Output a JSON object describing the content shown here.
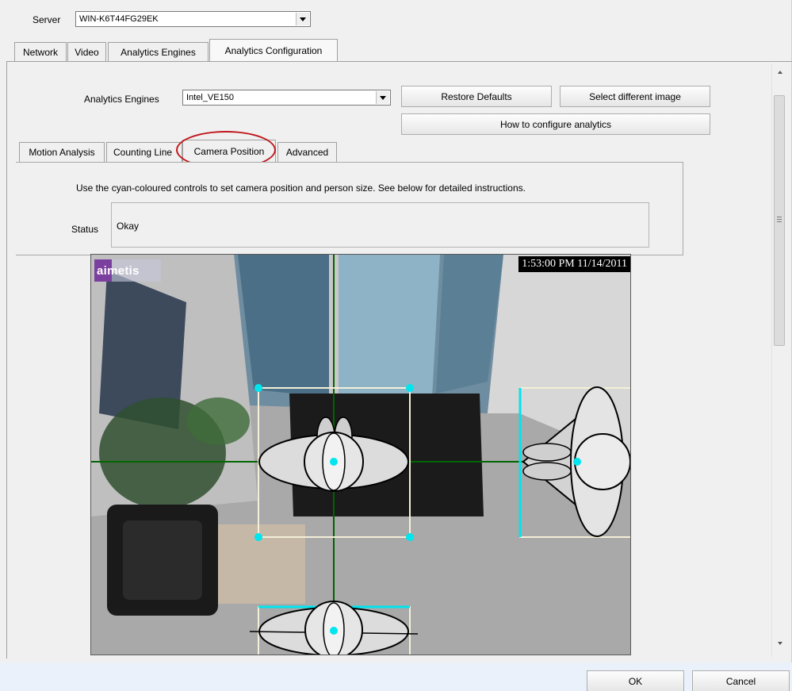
{
  "server": {
    "label": "Server",
    "value": "WIN-K6T44FG29EK"
  },
  "main_tabs": [
    {
      "label": "Network"
    },
    {
      "label": "Video"
    },
    {
      "label": "Analytics Engines"
    },
    {
      "label": "Analytics Configuration",
      "active": true
    }
  ],
  "analytics_engines": {
    "label": "Analytics Engines",
    "value": "Intel_VE150"
  },
  "buttons": {
    "restore_defaults": "Restore Defaults",
    "select_image": "Select different image",
    "how_to": "How to configure analytics",
    "ok": "OK",
    "cancel": "Cancel"
  },
  "sub_tabs": [
    {
      "label": "Motion Analysis"
    },
    {
      "label": "Counting Line"
    },
    {
      "label": "Camera Position",
      "active": true,
      "highlighted": true
    },
    {
      "label": "Advanced"
    }
  ],
  "instructions": "Use the cyan-coloured controls to set camera position and person size. See below for detailed instructions.",
  "status": {
    "label": "Status",
    "value": "Okay"
  },
  "video": {
    "logo": "aimetis",
    "timestamp": "1:53:00 PM 11/14/2011"
  },
  "icons": {
    "dropdown": "chevron-down-icon",
    "scroll_up": "scroll-up-arrow-icon",
    "scroll_down": "scroll-down-arrow-icon"
  },
  "colors": {
    "control": "#00e5ee",
    "axis": "#006400",
    "highlight": "#c0171c",
    "logo_bg": "#7b3fa0"
  }
}
